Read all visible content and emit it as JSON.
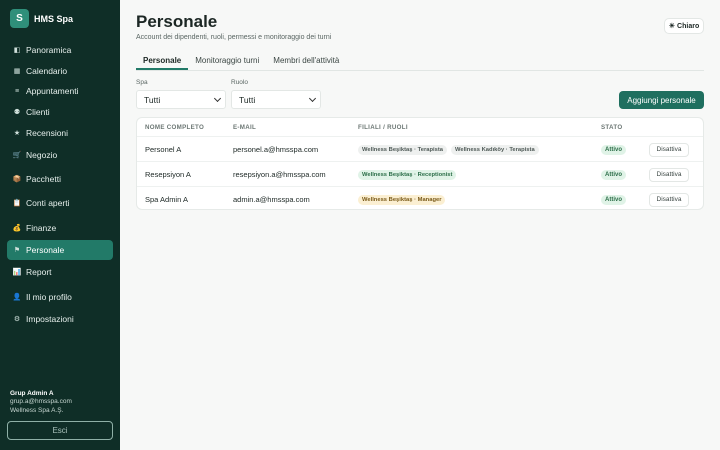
{
  "brand": {
    "logo_letter": "S",
    "name": "HMS Spa"
  },
  "sidebar": {
    "items": [
      {
        "label": "Panoramica",
        "icon": "◧",
        "active": false
      },
      {
        "label": "Calendario",
        "icon": "▦",
        "active": false
      },
      {
        "label": "Appuntamenti",
        "icon": "≡",
        "active": false
      },
      {
        "label": "Clienti",
        "icon": "⚉",
        "active": false
      },
      {
        "label": "Recensioni",
        "icon": "★",
        "active": false
      },
      {
        "label": "Negozio",
        "icon": "🛒",
        "active": false
      },
      {
        "label": "Pacchetti",
        "icon": "📦",
        "active": false
      },
      {
        "label": "Conti aperti",
        "icon": "📋",
        "active": false
      },
      {
        "label": "Finanze",
        "icon": "💰",
        "active": false
      },
      {
        "label": "Personale",
        "icon": "⚑",
        "active": true
      },
      {
        "label": "Report",
        "icon": "📊",
        "active": false
      },
      {
        "label": "Il mio profilo",
        "icon": "👤",
        "active": false
      },
      {
        "label": "Impostazioni",
        "icon": "⚙",
        "active": false
      }
    ]
  },
  "user": {
    "name": "Grup Admin A",
    "email": "grup.a@hmsspa.com",
    "company": "Wellness Spa A.Ş."
  },
  "logout_label": "Esci",
  "header": {
    "title": "Personale",
    "subtitle": "Account dei dipendenti, ruoli, permessi e monitoraggio dei turni",
    "theme_icon": "☀",
    "theme_label": "Chiaro"
  },
  "tabs": [
    {
      "label": "Personale",
      "active": true
    },
    {
      "label": "Monitoraggio turni",
      "active": false
    },
    {
      "label": "Membri dell'attività",
      "active": false
    }
  ],
  "filters": {
    "spa_label": "Spa",
    "spa_value": "Tutti",
    "role_label": "Ruolo",
    "role_value": "Tutti"
  },
  "add_button_label": "Aggiungi personale",
  "table": {
    "headers": {
      "name": "NOME COMPLETO",
      "email": "E-MAIL",
      "branches": "FILIALI / RUOLI",
      "status": "STATO"
    },
    "rows": [
      {
        "name": "Personel A",
        "email": "personel.a@hmsspa.com",
        "branches": [
          {
            "label": "Wellness Beşiktaş · Terapista",
            "color": "grey"
          },
          {
            "label": "Wellness Kadıköy · Terapista",
            "color": "grey"
          }
        ],
        "status": "Attivo",
        "action": "Disattiva"
      },
      {
        "name": "Resepsiyon A",
        "email": "resepsiyon.a@hmsspa.com",
        "branches": [
          {
            "label": "Wellness Beşiktaş · Receptionist",
            "color": "green"
          }
        ],
        "status": "Attivo",
        "action": "Disattiva"
      },
      {
        "name": "Spa Admin A",
        "email": "admin.a@hmsspa.com",
        "branches": [
          {
            "label": "Wellness Beşiktaş · Manager",
            "color": "yellow"
          }
        ],
        "status": "Attivo",
        "action": "Disattiva"
      }
    ]
  }
}
